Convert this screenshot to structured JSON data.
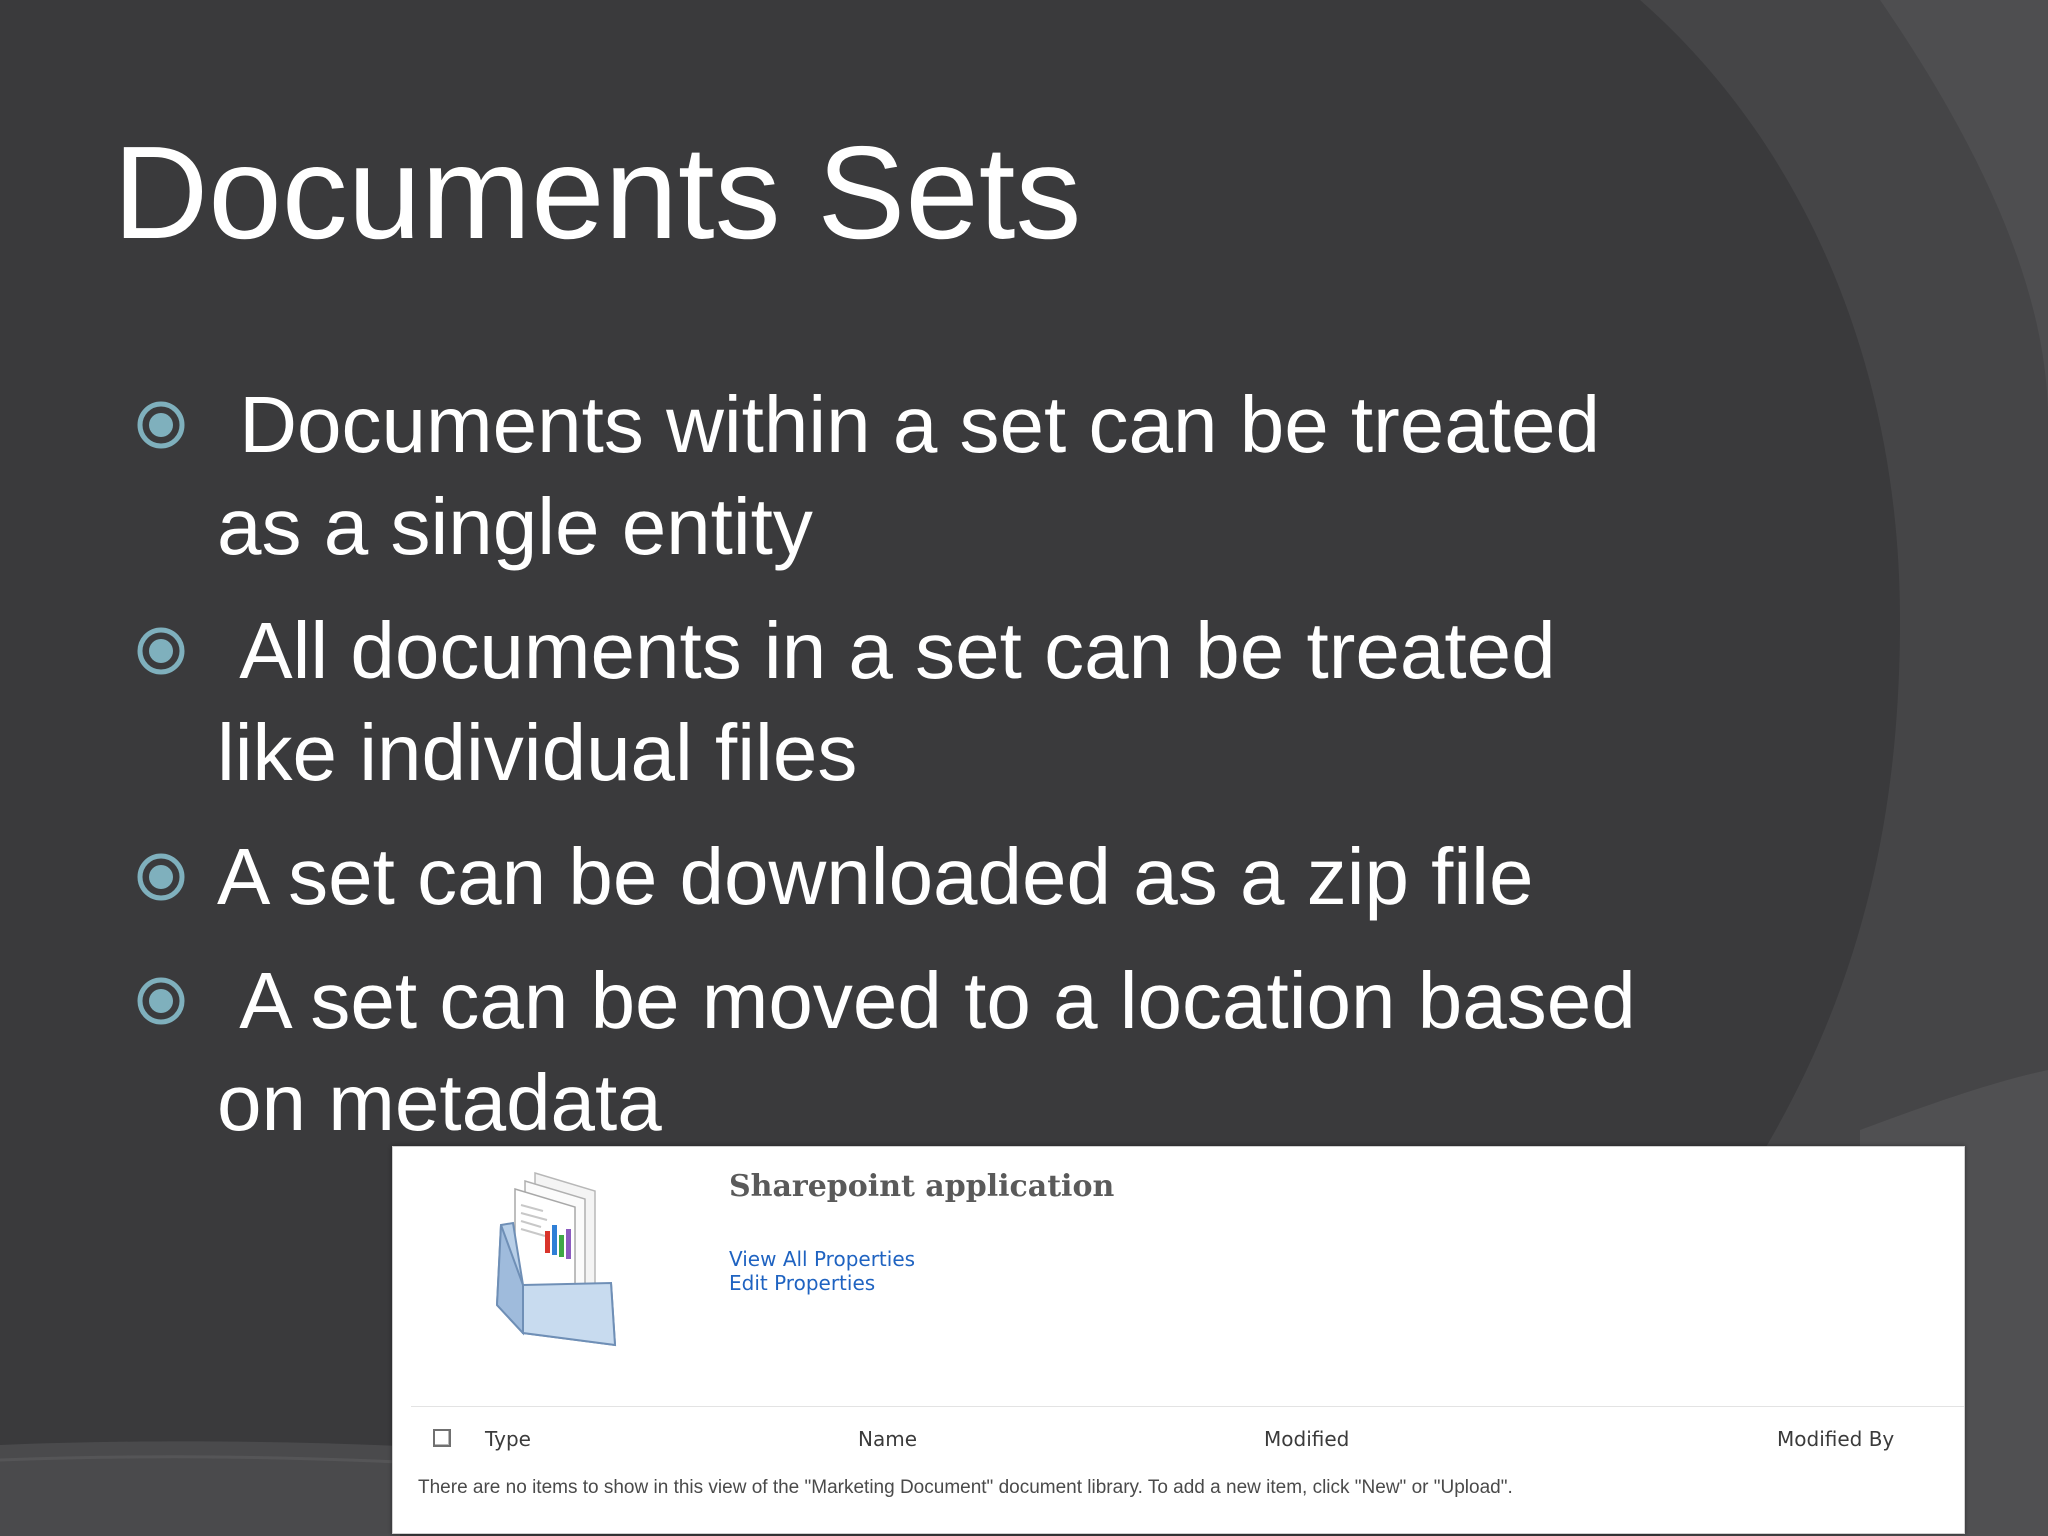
{
  "slide": {
    "title": "Documents Sets",
    "bullets": [
      " Documents within a set can be treated\nas a single entity",
      " All documents in a set can be treated\nlike individual files",
      "A set can be downloaded as a zip file",
      " A set can be moved to a location based\non metadata"
    ]
  },
  "sharepoint": {
    "title": "Sharepoint application",
    "links": {
      "view_all": "View All Properties",
      "edit": "Edit Properties"
    },
    "columns": {
      "type": "Type",
      "name": "Name",
      "modified": "Modified",
      "modified_by": "Modified By"
    },
    "empty_message": "There are no items to show in this view of the \"Marketing Document\" document library. To add a new item, click \"New\" or \"Upload\"."
  },
  "colors": {
    "background": "#3a3a3c",
    "arc_dark": "#434345",
    "bullet_accent": "#7fb0bd",
    "link": "#1f63c1"
  }
}
